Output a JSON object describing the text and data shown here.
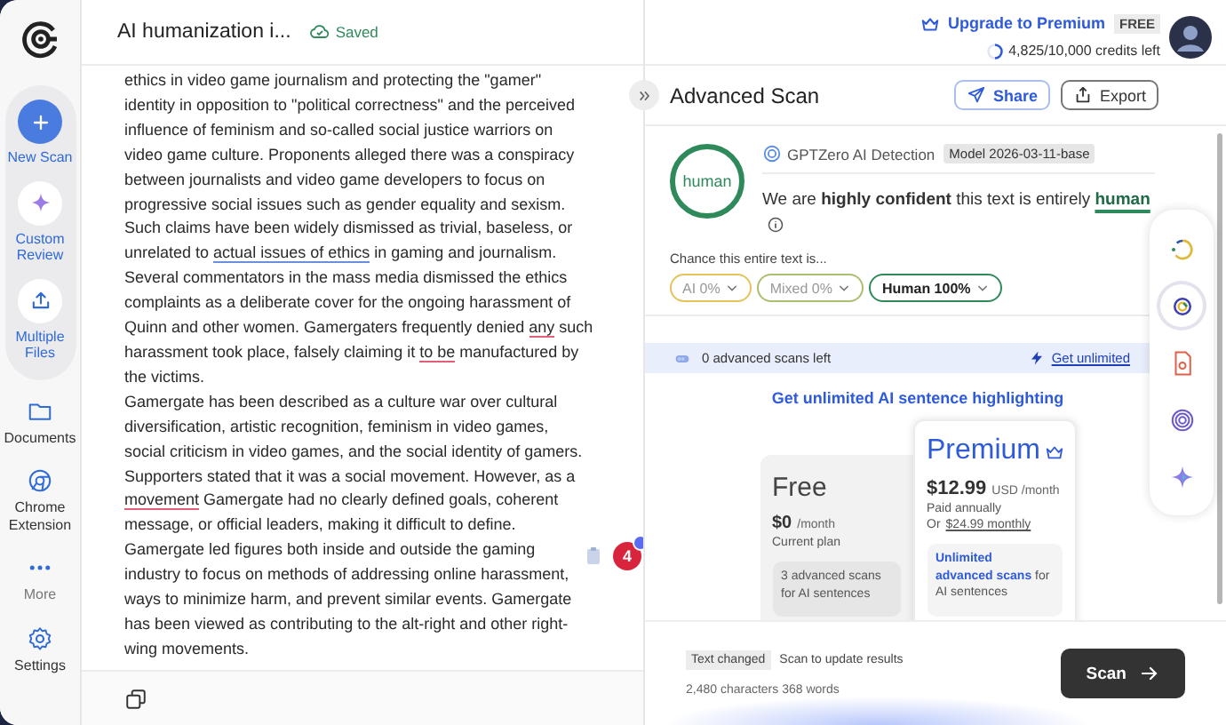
{
  "document": {
    "title": "AI humanization i...",
    "save_status": "Saved"
  },
  "account": {
    "upgrade": "Upgrade to Premium",
    "plan": "FREE",
    "credits": "4,825/10,000 credits left"
  },
  "sidebar": {
    "items": [
      {
        "label": "New Scan",
        "kind": "primary"
      },
      {
        "label": "Custom Review",
        "kind": "action"
      },
      {
        "label": "Multiple Files",
        "kind": "action"
      },
      {
        "label": "Documents",
        "kind": "nav"
      },
      {
        "label": "Chrome Extension",
        "kind": "nav"
      },
      {
        "label": "More",
        "kind": "muted"
      },
      {
        "label": "Settings",
        "kind": "nav"
      }
    ]
  },
  "editor": {
    "paragraphs": [
      {
        "lines": [
          [
            "ethics in video game journalism and protecting the \"gamer\""
          ],
          [
            "identity in opposition to \"political correctness\" and the perceived"
          ],
          [
            "influence of feminism and so-called social justice warriors on"
          ],
          [
            "video game culture. Proponents alleged there was a conspiracy"
          ],
          [
            "between journalists and video game developers to focus on"
          ],
          [
            "progressive social issues such as gender equality and sexism."
          ],
          [
            "Such claims have been widely dismissed as trivial, baseless, or"
          ],
          [
            "unrelated to ",
            {
              "text": "actual issues of ethics",
              "color": "#6b8fe0"
            },
            " in gaming and journalism."
          ],
          [
            "Several commentators in the mass media dismissed the ethics"
          ],
          [
            "complaints as a deliberate cover for the ongoing harassment of"
          ],
          [
            "Quinn and other women. Gamergaters frequently denied ",
            {
              "text": "any",
              "color": "#e0607a"
            },
            " such"
          ],
          [
            "harassment took place, falsely claiming it ",
            {
              "text": "to be",
              "color": "#e0607a"
            },
            " manufactured by"
          ],
          [
            "the victims."
          ]
        ]
      },
      {
        "lines": [
          [
            "Gamergate has been described as a culture war over cultural"
          ],
          [
            "diversification, artistic recognition, feminism in video games,"
          ],
          [
            "social criticism in video games, and the social identity of gamers."
          ],
          [
            "Supporters stated that it was a social movement. However, as a"
          ],
          [
            {
              "text": "movement",
              "color": "#e0607a"
            },
            " Gamergate had no clearly defined goals, coherent"
          ],
          [
            "message, or official leaders, making it difficult to define."
          ]
        ]
      },
      {
        "lines": [
          [
            "Gamergate led figures both inside and outside the gaming"
          ],
          [
            "industry to focus on methods of addressing online harassment,"
          ],
          [
            "ways to minimize harm, and prevent similar events. Gamergate"
          ],
          [
            "has been viewed as contributing to the alt-right and other right-"
          ],
          [
            "wing movements."
          ]
        ]
      }
    ],
    "flag_count": "4"
  },
  "scan": {
    "title": "Advanced Scan",
    "share": "Share",
    "export": "Export",
    "verdict": "human",
    "detector": "GPTZero AI Detection",
    "model": "Model 2026-03-11-base",
    "summary": "We are **highly confident** this text is entirely",
    "summary_result": "human",
    "chance_label": "Chance this entire text is...",
    "chances": [
      {
        "label": "AI 0%",
        "color": "#e6c25a",
        "selected": false
      },
      {
        "label": "Mixed 0%",
        "color": "#a9bf6e",
        "selected": false
      },
      {
        "label": "Human 100%",
        "color": "#2e8a5a",
        "selected": true
      }
    ],
    "scans_left": "0 advanced scans left",
    "get_unlimited": "Get unlimited",
    "promo": "Get unlimited AI sentence highlighting",
    "plans": [
      {
        "kind": "free",
        "name": "Free",
        "price": "$0",
        "period": "/month",
        "note": "Current plan",
        "feature": "3 advanced scans for AI sentences"
      },
      {
        "kind": "premium",
        "name": "Premium",
        "price": "$12.99",
        "period": "USD /month",
        "note": "Paid annually",
        "alt_prefix": "Or",
        "alt_link": "$24.99 monthly",
        "feature_highlight": "Unlimited advanced scans",
        "feature": "for AI sentences"
      }
    ]
  },
  "tools": [
    {
      "selected": false
    },
    {
      "selected": true
    },
    {
      "selected": false
    },
    {
      "selected": false
    },
    {
      "selected": false
    }
  ],
  "footer": {
    "status_badge": "Text changed",
    "status": "Scan to update results",
    "counts": "2,480 characters 368 words",
    "scan": "Scan"
  }
}
